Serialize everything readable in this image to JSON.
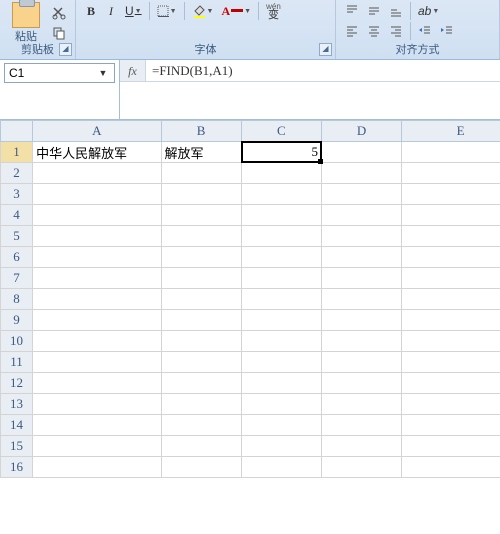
{
  "ribbon": {
    "clipboard": {
      "paste": "粘贴",
      "label": "剪贴板"
    },
    "font": {
      "bold": "B",
      "italic": "I",
      "underline": "U",
      "phonetic": "变",
      "phonetic2": "wén",
      "label": "字体"
    },
    "align": {
      "label": "对齐方式"
    }
  },
  "formula_bar": {
    "name_box": "C1",
    "fx_label": "fx",
    "formula": "=FIND(B1,A1)"
  },
  "grid": {
    "columns": [
      "A",
      "B",
      "C",
      "D",
      "E"
    ],
    "rows": [
      "1",
      "2",
      "3",
      "4",
      "5",
      "6",
      "7",
      "8",
      "9",
      "10",
      "11",
      "12",
      "13",
      "14",
      "15",
      "16"
    ],
    "active_col": "C",
    "active_row": "1",
    "cells": {
      "A1": "中华人民解放军",
      "B1": "解放军",
      "C1": "5"
    }
  }
}
